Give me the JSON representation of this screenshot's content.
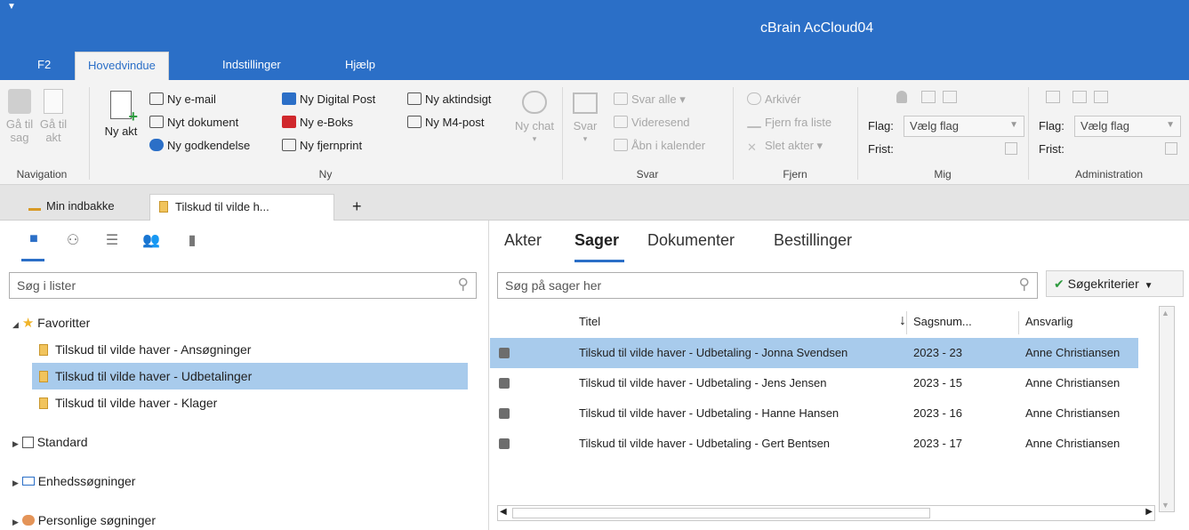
{
  "window": {
    "title": "cBrain AcCloud04"
  },
  "ribbon_tabs": [
    "F2",
    "Hovedvindue",
    "Indstillinger",
    "Hjælp"
  ],
  "ribbon": {
    "navigation": {
      "back_label": "Gå til sag",
      "fwd_label": "Gå til akt",
      "group_label": "Navigation"
    },
    "ny": {
      "ny_akt_label": "Ny akt",
      "items": [
        "Ny e-mail",
        "Nyt dokument",
        "Ny godkendelse",
        "Ny Digital Post",
        "Ny e-Boks",
        "Ny fjernprint",
        "Ny aktindsigt",
        "Ny M4-post"
      ],
      "ny_chat_label": "Ny chat",
      "group_label": "Ny"
    },
    "svar": {
      "svar_label": "Svar",
      "items": [
        "Svar alle",
        "Videresend",
        "Åbn i kalender"
      ],
      "group_label": "Svar"
    },
    "fjern": {
      "items": [
        "Arkivér",
        "Fjern fra liste",
        "Slet akter"
      ],
      "group_label": "Fjern"
    },
    "mig": {
      "flag_label": "Flag:",
      "flag_value": "Vælg flag",
      "frist_label": "Frist:",
      "group_label": "Mig"
    },
    "administration": {
      "flag_label": "Flag:",
      "flag_value": "Vælg flag",
      "frist_label": "Frist:",
      "group_label": "Administration"
    }
  },
  "doc_tabs": [
    "Min indbakke",
    "Tilskud til vilde h..."
  ],
  "doc_tab_add": "+",
  "left": {
    "search_placeholder": "Søg i lister",
    "favorites_label": "Favoritter",
    "favorites": [
      "Tilskud til vilde haver - Ansøgninger",
      "Tilskud til vilde haver - Udbetalinger",
      "Tilskud til vilde haver - Klager"
    ],
    "groups": [
      "Standard",
      "Enhedssøgninger",
      "Personlige søgninger"
    ]
  },
  "right": {
    "view_tabs": [
      "Akter",
      "Sager",
      "Dokumenter",
      "Bestillinger"
    ],
    "search_placeholder": "Søg på sager her",
    "criteria_button": "Søgekriterier",
    "columns": [
      "Titel",
      "Sagsnum...",
      "Ansvarlig"
    ],
    "rows": [
      {
        "title": "Tilskud til vilde haver - Udbetaling - Jonna Svendsen",
        "number": "2023 - 23",
        "owner": "Anne Christiansen"
      },
      {
        "title": "Tilskud til vilde haver - Udbetaling - Jens Jensen",
        "number": "2023 - 15",
        "owner": "Anne Christiansen"
      },
      {
        "title": "Tilskud til vilde haver - Udbetaling - Hanne Hansen",
        "number": "2023 - 16",
        "owner": "Anne Christiansen"
      },
      {
        "title": "Tilskud til vilde haver - Udbetaling - Gert Bentsen",
        "number": "2023 - 17",
        "owner": "Anne Christiansen"
      }
    ]
  },
  "colors": {
    "brand": "#2b6fc7",
    "selection": "#a8cbec"
  }
}
